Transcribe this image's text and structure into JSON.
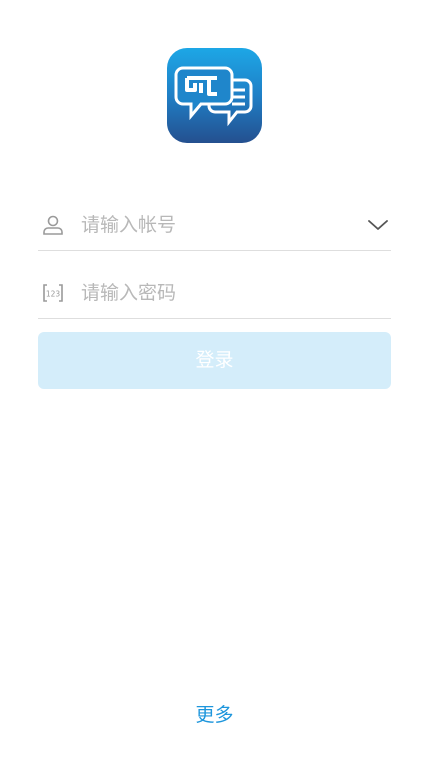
{
  "login": {
    "account_placeholder": "请输入帐号",
    "password_placeholder": "请输入密码",
    "login_label": "登录",
    "more_label": "更多"
  },
  "icons": {
    "logo": "chat-bubbles-logo-icon",
    "account": "user-icon",
    "password": "password-keypad-icon",
    "dropdown": "chevron-down-icon"
  },
  "colors": {
    "logo_gradient_top": "#1da7e6",
    "logo_gradient_bottom": "#24508f",
    "login_button_bg": "#d4edfa",
    "link": "#1e96dc",
    "placeholder": "#b8b8b8"
  }
}
